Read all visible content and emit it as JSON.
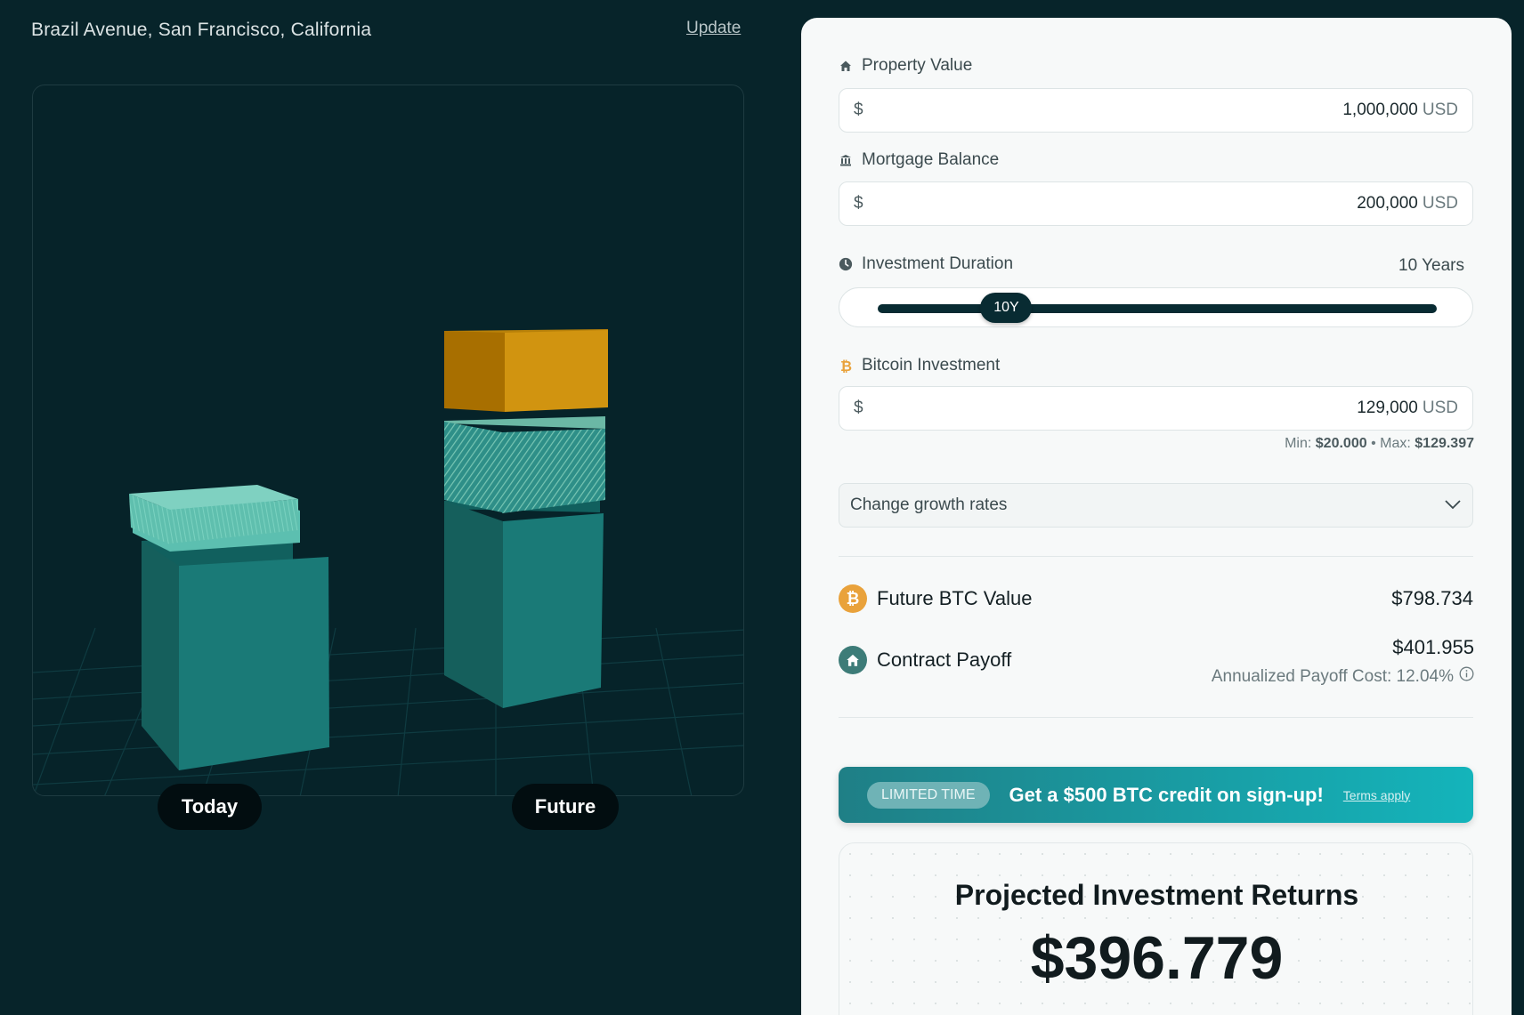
{
  "header": {
    "address": "Brazil Avenue, San Francisco, California",
    "update_link": "Update"
  },
  "visualization": {
    "today_label": "Today",
    "future_label": "Future",
    "colors": {
      "property": "#1a7a77",
      "property_side": "#11605e",
      "equity": "#5cbfb0",
      "bitcoin": "#d19410",
      "bitcoin_side": "#a86f00",
      "grid": "#0e3a3f"
    }
  },
  "form": {
    "property_value": {
      "label": "Property Value",
      "currency": "$",
      "value": "1,000,000",
      "unit": "USD",
      "icon": "home-icon"
    },
    "mortgage_balance": {
      "label": "Mortgage Balance",
      "currency": "$",
      "value": "200,000",
      "unit": "USD",
      "icon": "bank-icon"
    },
    "investment_duration": {
      "label": "Investment Duration",
      "value_text": "10 Years",
      "thumb_label": "10Y",
      "level": 0.23,
      "icon": "clock-icon"
    },
    "bitcoin_investment": {
      "label": "Bitcoin Investment",
      "currency": "$",
      "value": "129,000",
      "unit": "USD",
      "icon": "bitcoin-icon",
      "min_label": "Min:",
      "min_value": "$20.000",
      "separator": "•",
      "max_label": "Max:",
      "max_value": "$129.397"
    },
    "growth_rates": {
      "label": "Change growth rates",
      "icon": "chevron-down-icon"
    }
  },
  "results": {
    "future_btc": {
      "label": "Future BTC Value",
      "value": "$798.734",
      "icon_glyph": "₿",
      "color": "#e9a23b"
    },
    "contract_payoff": {
      "label": "Contract Payoff",
      "value": "$401.955",
      "annualized_text": "Annualized Payoff Cost: 12.04%",
      "color": "#3d7c78"
    }
  },
  "promo": {
    "badge": "LIMITED TIME",
    "message": "Get a $500 BTC credit on sign-up!",
    "terms": "Terms apply"
  },
  "returns": {
    "title": "Projected Investment Returns",
    "value": "$396.779"
  }
}
